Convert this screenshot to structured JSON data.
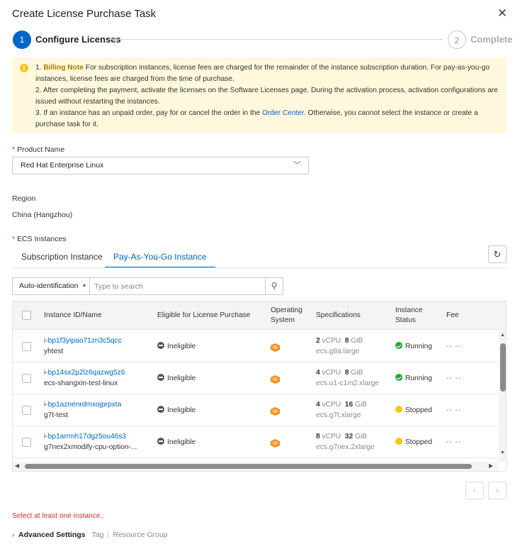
{
  "dialog": {
    "title": "Create License Purchase Task",
    "close_glyph": "✕"
  },
  "steps": [
    {
      "number": "1",
      "label": "Configure Licenses"
    },
    {
      "number": "2",
      "label": "Complete"
    }
  ],
  "notice": {
    "icon_glyph": "!",
    "line1_prefix": "1. ",
    "line1_bold": "Billing Note",
    "line1_text": " For subscription instances, license fees are charged for the remainder of the instance subscription duration. For pay-as-you-go instances, license fees are charged from the time of purchase.",
    "line2": "2. After completing the payment, activate the licenses on the Software Licenses page. During the activation process, activation configurations are issued without restarting the instances.",
    "line3_prefix": "3. If an instance has an unpaid order, pay for or cancel the order in the ",
    "line3_link": "Order Center",
    "line3_suffix": ". Otherwise, you cannot select the instance or create a purchase task for it."
  },
  "product": {
    "required_mark": "*",
    "label": "Product Name",
    "value": "Red Hat Enterprise Linux",
    "chevron": "﹀"
  },
  "region": {
    "label": "Region",
    "value": "China (Hangzhou)"
  },
  "ecs": {
    "required_mark": "*",
    "label": "ECS Instances"
  },
  "tabs": [
    {
      "label": "Subscription Instance",
      "active": false
    },
    {
      "label": "Pay-As-You-Go Instance",
      "active": true
    }
  ],
  "refresh_glyph": "↻",
  "search": {
    "type_label": "Auto-identification",
    "caret": "▼",
    "placeholder": "Type to search",
    "search_glyph": "⚲"
  },
  "table": {
    "columns": {
      "instance": "Instance ID/Name",
      "eligible": "Eligible for License Purchase",
      "os_line1": "Operating",
      "os_line2": "System",
      "specs": "Specifications",
      "status_line1": "Instance",
      "status_line2": "Status",
      "fee": "Fee"
    },
    "rows": [
      {
        "id": "i-bp1f3yipao71zn3c5qcc",
        "name": "yhtest",
        "eligible": "Ineligible",
        "vcpu": "2",
        "vcpu_unit": "vCPU",
        "mem": "8",
        "mem_unit": "GiB",
        "type": "ecs.g8a.large",
        "status": "Running",
        "fee": "-- --"
      },
      {
        "id": "i-bp14sx2p2lz6qazwg5z6",
        "name": "ecs-shangxin-test-linux",
        "eligible": "Ineligible",
        "vcpu": "4",
        "vcpu_unit": "vCPU",
        "mem": "8",
        "mem_unit": "GiB",
        "type": "ecs.u1-c1m2.xlarge",
        "status": "Running",
        "fee": "-- --"
      },
      {
        "id": "i-bp1aznenrdmxojprpxta",
        "name": "g7t-test",
        "eligible": "Ineligible",
        "vcpu": "4",
        "vcpu_unit": "vCPU",
        "mem": "16",
        "mem_unit": "GiB",
        "type": "ecs.g7t.xlarge",
        "status": "Stopped",
        "fee": "-- --"
      },
      {
        "id": "i-bp1arrmh17dgz5ou46s3",
        "name": "g7nex2xmodify-cpu-option-...",
        "eligible": "Ineligible",
        "vcpu": "8",
        "vcpu_unit": "vCPU",
        "mem": "32",
        "mem_unit": "GiB",
        "type": "ecs.g7nex.2xlarge",
        "status": "Stopped",
        "fee": "-- --"
      }
    ]
  },
  "scroll_glyphs": {
    "up": "▲",
    "down": "▼",
    "left": "◀",
    "right": "▶"
  },
  "pagination": {
    "prev": "‹",
    "next": "›"
  },
  "error": "Select at least one instance.",
  "advanced": {
    "chevron": "›",
    "title": "Advanced Settings",
    "tag": "Tag",
    "resource_group": "Resource Group"
  },
  "colors": {
    "primary": "#0064c8",
    "notice_bg": "#fff8dc",
    "running": "#22a834",
    "stopped": "#f5c518",
    "error": "#d93026",
    "fee": "#e65a2e"
  }
}
